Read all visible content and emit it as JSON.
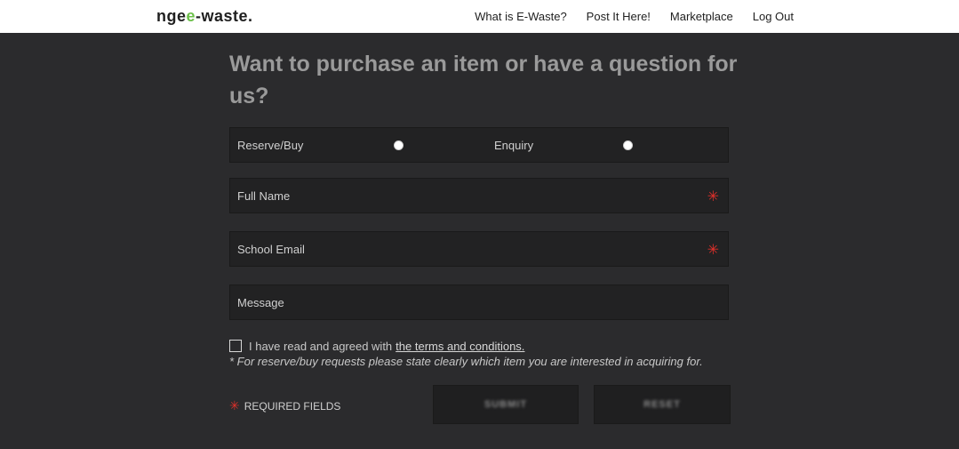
{
  "header": {
    "logo_prefix": "nge",
    "logo_accent": "e",
    "logo_suffix": "-waste.",
    "nav": [
      "What is E-Waste?",
      "Post It Here!",
      "Marketplace",
      "Log Out"
    ]
  },
  "form": {
    "title": "Want to purchase an item or have a question for us?",
    "type_options": [
      "Reserve/Buy",
      "Enquiry"
    ],
    "fields": {
      "full_name": "Full Name",
      "school_email": "School Email",
      "message": "Message"
    },
    "required_mark": "✳",
    "terms_prefix": "I have read and agreed with",
    "terms_link": "the terms and conditions.",
    "note": "* For reserve/buy requests please state clearly which item you are interested in acquiring for.",
    "required_label": "REQUIRED FIELDS",
    "submit": "SUBMIT",
    "reset": "RESET"
  },
  "colors": {
    "background": "#2b2b2d",
    "accent_green": "#6cc04a",
    "required_red": "#e0302a"
  }
}
